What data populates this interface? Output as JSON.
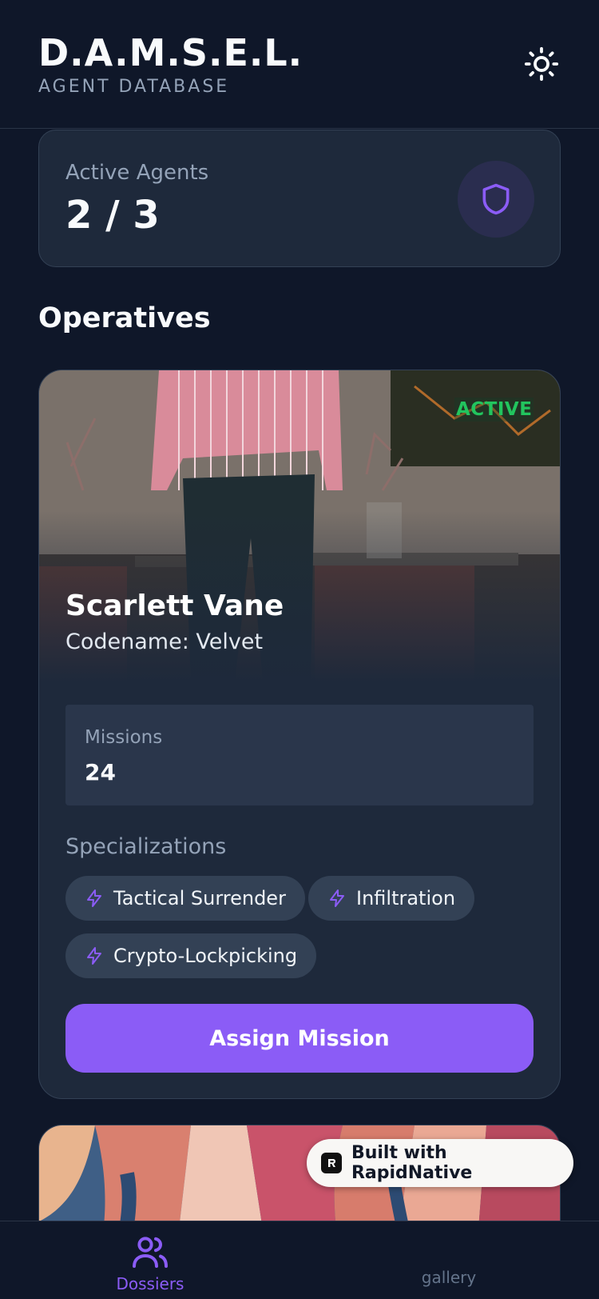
{
  "header": {
    "title": "D.A.M.S.E.L.",
    "subtitle": "AGENT DATABASE",
    "theme_icon": "sun-icon"
  },
  "stats": {
    "label": "Active Agents",
    "value": "2 / 3",
    "icon": "shield-icon"
  },
  "section": {
    "title": "Operatives"
  },
  "agents": [
    {
      "status": "ACTIVE",
      "name": "Scarlett Vane",
      "codename": "Codename: Velvet",
      "missions_label": "Missions",
      "missions_value": "24",
      "specializations_label": "Specializations",
      "specializations": [
        "Tactical Surrender",
        "Infiltration",
        "Crypto-Lockpicking"
      ],
      "action_label": "Assign Mission"
    }
  ],
  "badge": {
    "label": "Built with RapidNative"
  },
  "nav": {
    "items": [
      {
        "label": "Dossiers",
        "icon": "users-icon",
        "active": true
      },
      {
        "label": "gallery",
        "icon": "image-icon",
        "active": false
      }
    ]
  },
  "colors": {
    "background": "#0f1729",
    "card": "#1e293b",
    "accent": "#8b5cf6",
    "status_active": "#22c55e",
    "muted_text": "#94a3b8"
  }
}
